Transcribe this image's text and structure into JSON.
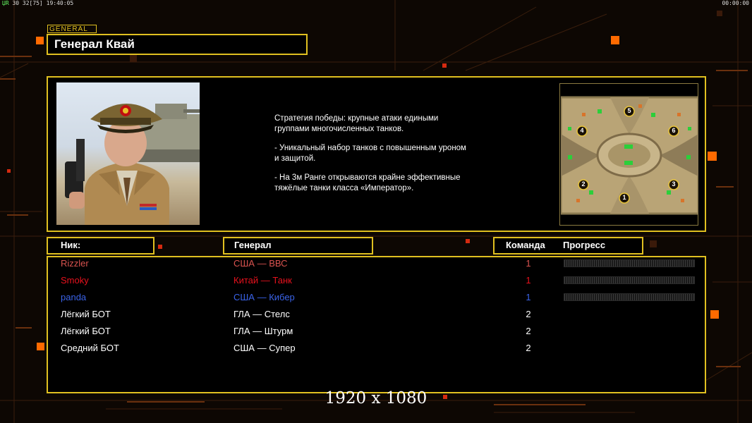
{
  "status": {
    "fps_prefix": "ЏR",
    "fps_text": "30 32[75] 19:40:05",
    "timer": "00:00:00"
  },
  "general_tag": "GENERAL",
  "general_name": "Генерал Квай",
  "strategy": [
    "Стратегия победы: крупные атаки едиными\n группами многочисленных танков.",
    "- Уникальный набор танков с повышенным уроном\n и защитой.",
    "- На 3м Ранге открываются крайне эффективные\n тяжёлые танки класса «Император»."
  ],
  "headers": {
    "nick": "Ник:",
    "general": "Генерал",
    "team": "Команда",
    "progress": "Прогресс"
  },
  "players": [
    {
      "nick": "Rizzler",
      "general": "США — ВВС",
      "team": "1",
      "color": "#d9534f",
      "has_progress": true
    },
    {
      "nick": "Smoky",
      "general": "Китай — Танк",
      "team": "1",
      "color": "#e8111d",
      "has_progress": true
    },
    {
      "nick": "panda",
      "general": "США — Кибер",
      "team": "1",
      "color": "#3a63e8",
      "has_progress": true
    },
    {
      "nick": "Лёгкий БОТ",
      "general": "ГЛА — Стелс",
      "team": "2",
      "color": "#ffffff",
      "has_progress": false
    },
    {
      "nick": "Лёгкий БОТ",
      "general": "ГЛА — Штурм",
      "team": "2",
      "color": "#ffffff",
      "has_progress": false
    },
    {
      "nick": "Средний БОТ",
      "general": "США — Супер",
      "team": "2",
      "color": "#ffffff",
      "has_progress": false
    }
  ],
  "minimap_slots": [
    "5",
    "4",
    "6",
    "2",
    "3",
    "1"
  ],
  "resolution": "1920 x 1080",
  "colors": {
    "accent": "#e0c020",
    "background": "#0d0703",
    "glow": "#ff6a00"
  }
}
